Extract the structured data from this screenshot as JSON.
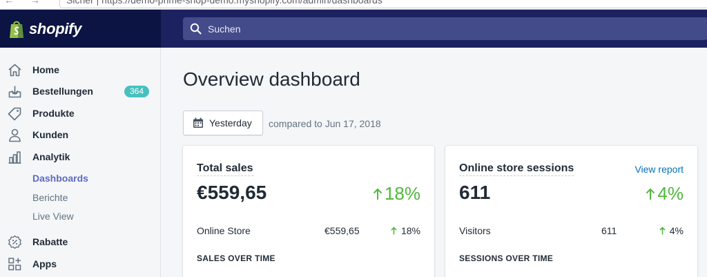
{
  "browser": {
    "url": "Sicher | https://demo-prime-shop-demo.myshopify.com/admin/dashboards"
  },
  "topbar": {
    "logo_text": "shopify",
    "search_placeholder": "Suchen"
  },
  "sidebar": {
    "items": [
      {
        "label": "Home",
        "icon": "home-icon"
      },
      {
        "label": "Bestellungen",
        "icon": "orders-icon",
        "badge": "364"
      },
      {
        "label": "Produkte",
        "icon": "tag-icon"
      },
      {
        "label": "Kunden",
        "icon": "person-icon"
      },
      {
        "label": "Analytik",
        "icon": "bar-chart-icon"
      },
      {
        "label": "Rabatte",
        "icon": "discount-icon"
      },
      {
        "label": "Apps",
        "icon": "apps-icon"
      }
    ],
    "analytics_sub": [
      {
        "label": "Dashboards",
        "active": true
      },
      {
        "label": "Berichte",
        "active": false
      },
      {
        "label": "Live View",
        "active": false
      }
    ]
  },
  "main": {
    "title": "Overview dashboard",
    "date_button": "Yesterday",
    "compare_text": "compared to Jun 17, 2018"
  },
  "cards": [
    {
      "title": "Total sales",
      "link": "",
      "big_value": "€559,65",
      "big_pct": "18%",
      "row_label": "Online Store",
      "row_value": "€559,65",
      "row_pct": "18%",
      "section": "SALES OVER TIME"
    },
    {
      "title": "Online store sessions",
      "link": "View report",
      "big_value": "611",
      "big_pct": "4%",
      "row_label": "Visitors",
      "row_value": "611",
      "row_pct": "4%",
      "section": "SESSIONS OVER TIME"
    }
  ],
  "colors": {
    "topbar": "#1c2260",
    "logo_area": "#0b1443",
    "accent": "#5c6ac4",
    "positive": "#50b83c",
    "badge": "#47c1bf",
    "link": "#006fbb"
  }
}
